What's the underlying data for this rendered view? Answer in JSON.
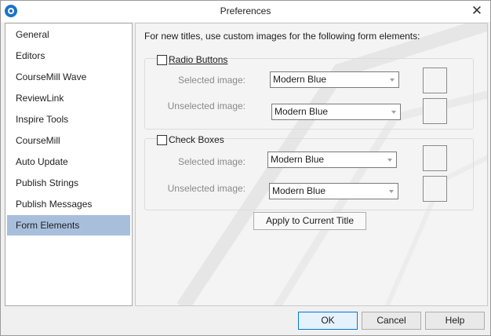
{
  "window": {
    "title": "Preferences"
  },
  "sidebar": {
    "items": [
      {
        "label": "General",
        "selected": false
      },
      {
        "label": "Editors",
        "selected": false
      },
      {
        "label": "CourseMill Wave",
        "selected": false
      },
      {
        "label": "ReviewLink",
        "selected": false
      },
      {
        "label": "Inspire Tools",
        "selected": false
      },
      {
        "label": "CourseMill",
        "selected": false
      },
      {
        "label": "Auto Update",
        "selected": false
      },
      {
        "label": "Publish Strings",
        "selected": false
      },
      {
        "label": "Publish Messages",
        "selected": false
      },
      {
        "label": "Form Elements",
        "selected": true
      }
    ]
  },
  "main": {
    "intro": "For new titles, use custom images for the following form elements:",
    "radio_group": {
      "label": "Radio Buttons",
      "checked": false,
      "selected_label": "Selected image:",
      "selected_value": "Modern Blue",
      "unselected_label": "Unselected image:",
      "unselected_value": "Modern Blue"
    },
    "check_group": {
      "label": "Check Boxes",
      "checked": false,
      "selected_label": "Selected image:",
      "selected_value": "Modern Blue",
      "unselected_label": "Unselected image:",
      "unselected_value": "Modern Blue"
    },
    "apply_button": "Apply to Current Title"
  },
  "footer": {
    "ok": "OK",
    "cancel": "Cancel",
    "help": "Help"
  },
  "colors": {
    "selection": "#a8bfdc",
    "accent": "#0078d7",
    "app_icon": "#1a73c9"
  }
}
